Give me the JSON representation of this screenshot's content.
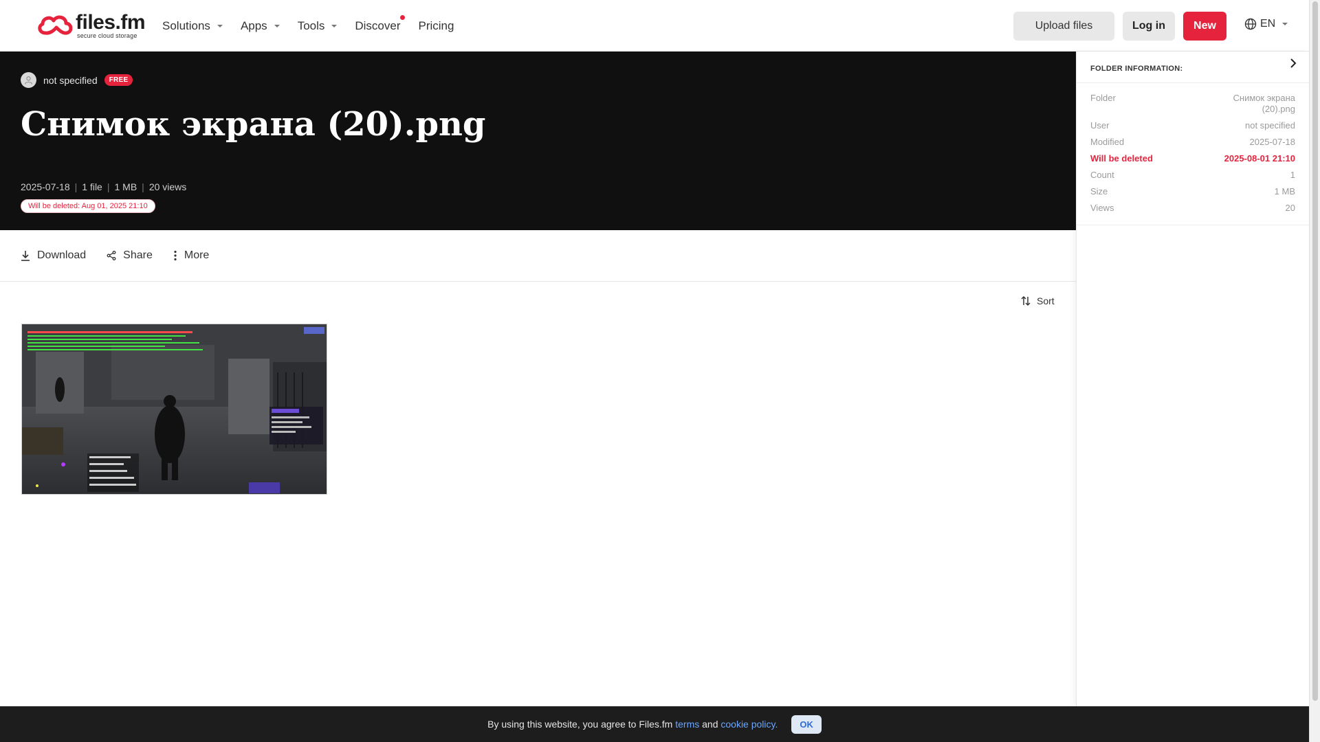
{
  "header": {
    "logo_text": "files.fm",
    "logo_tagline": "secure cloud storage",
    "nav": [
      {
        "label": "Solutions",
        "has_caret": true
      },
      {
        "label": "Apps",
        "has_caret": true
      },
      {
        "label": "Tools",
        "has_caret": true
      },
      {
        "label": "Discover",
        "has_dot": true
      },
      {
        "label": "Pricing"
      }
    ],
    "upload_label": "Upload files",
    "login_label": "Log in",
    "new_label": "New",
    "language": "EN"
  },
  "hero": {
    "owner": "not specified",
    "plan_badge": "FREE",
    "title": "Снимок экрана (20).png",
    "meta": {
      "date": "2025-07-18",
      "files": "1 file",
      "size": "1 MB",
      "views": "20 views"
    },
    "delete_notice": "Will be deleted: Aug 01, 2025 21:10"
  },
  "actions": {
    "download": "Download",
    "share": "Share",
    "more": "More"
  },
  "content": {
    "sort_label": "Sort"
  },
  "panel": {
    "title": "FOLDER INFORMATION:",
    "rows": [
      {
        "key": "Folder",
        "value": "Снимок экрана (20).png"
      },
      {
        "key": "User",
        "value": "not specified"
      },
      {
        "key": "Modified",
        "value": "2025-07-18"
      },
      {
        "key": "Will be deleted",
        "value": "2025-08-01 21:10"
      },
      {
        "key": "Count",
        "value": "1"
      },
      {
        "key": "Size",
        "value": "1 MB"
      },
      {
        "key": "Views",
        "value": "20"
      }
    ]
  },
  "cookie": {
    "text_before": "By using this website, you agree to Files.fm ",
    "terms": "terms",
    "and": " and ",
    "policy": "cookie policy.",
    "ok": "OK"
  },
  "colors": {
    "brand_red": "#e5233d",
    "hero_bg": "#101010",
    "link_blue": "#6aa7ff"
  }
}
